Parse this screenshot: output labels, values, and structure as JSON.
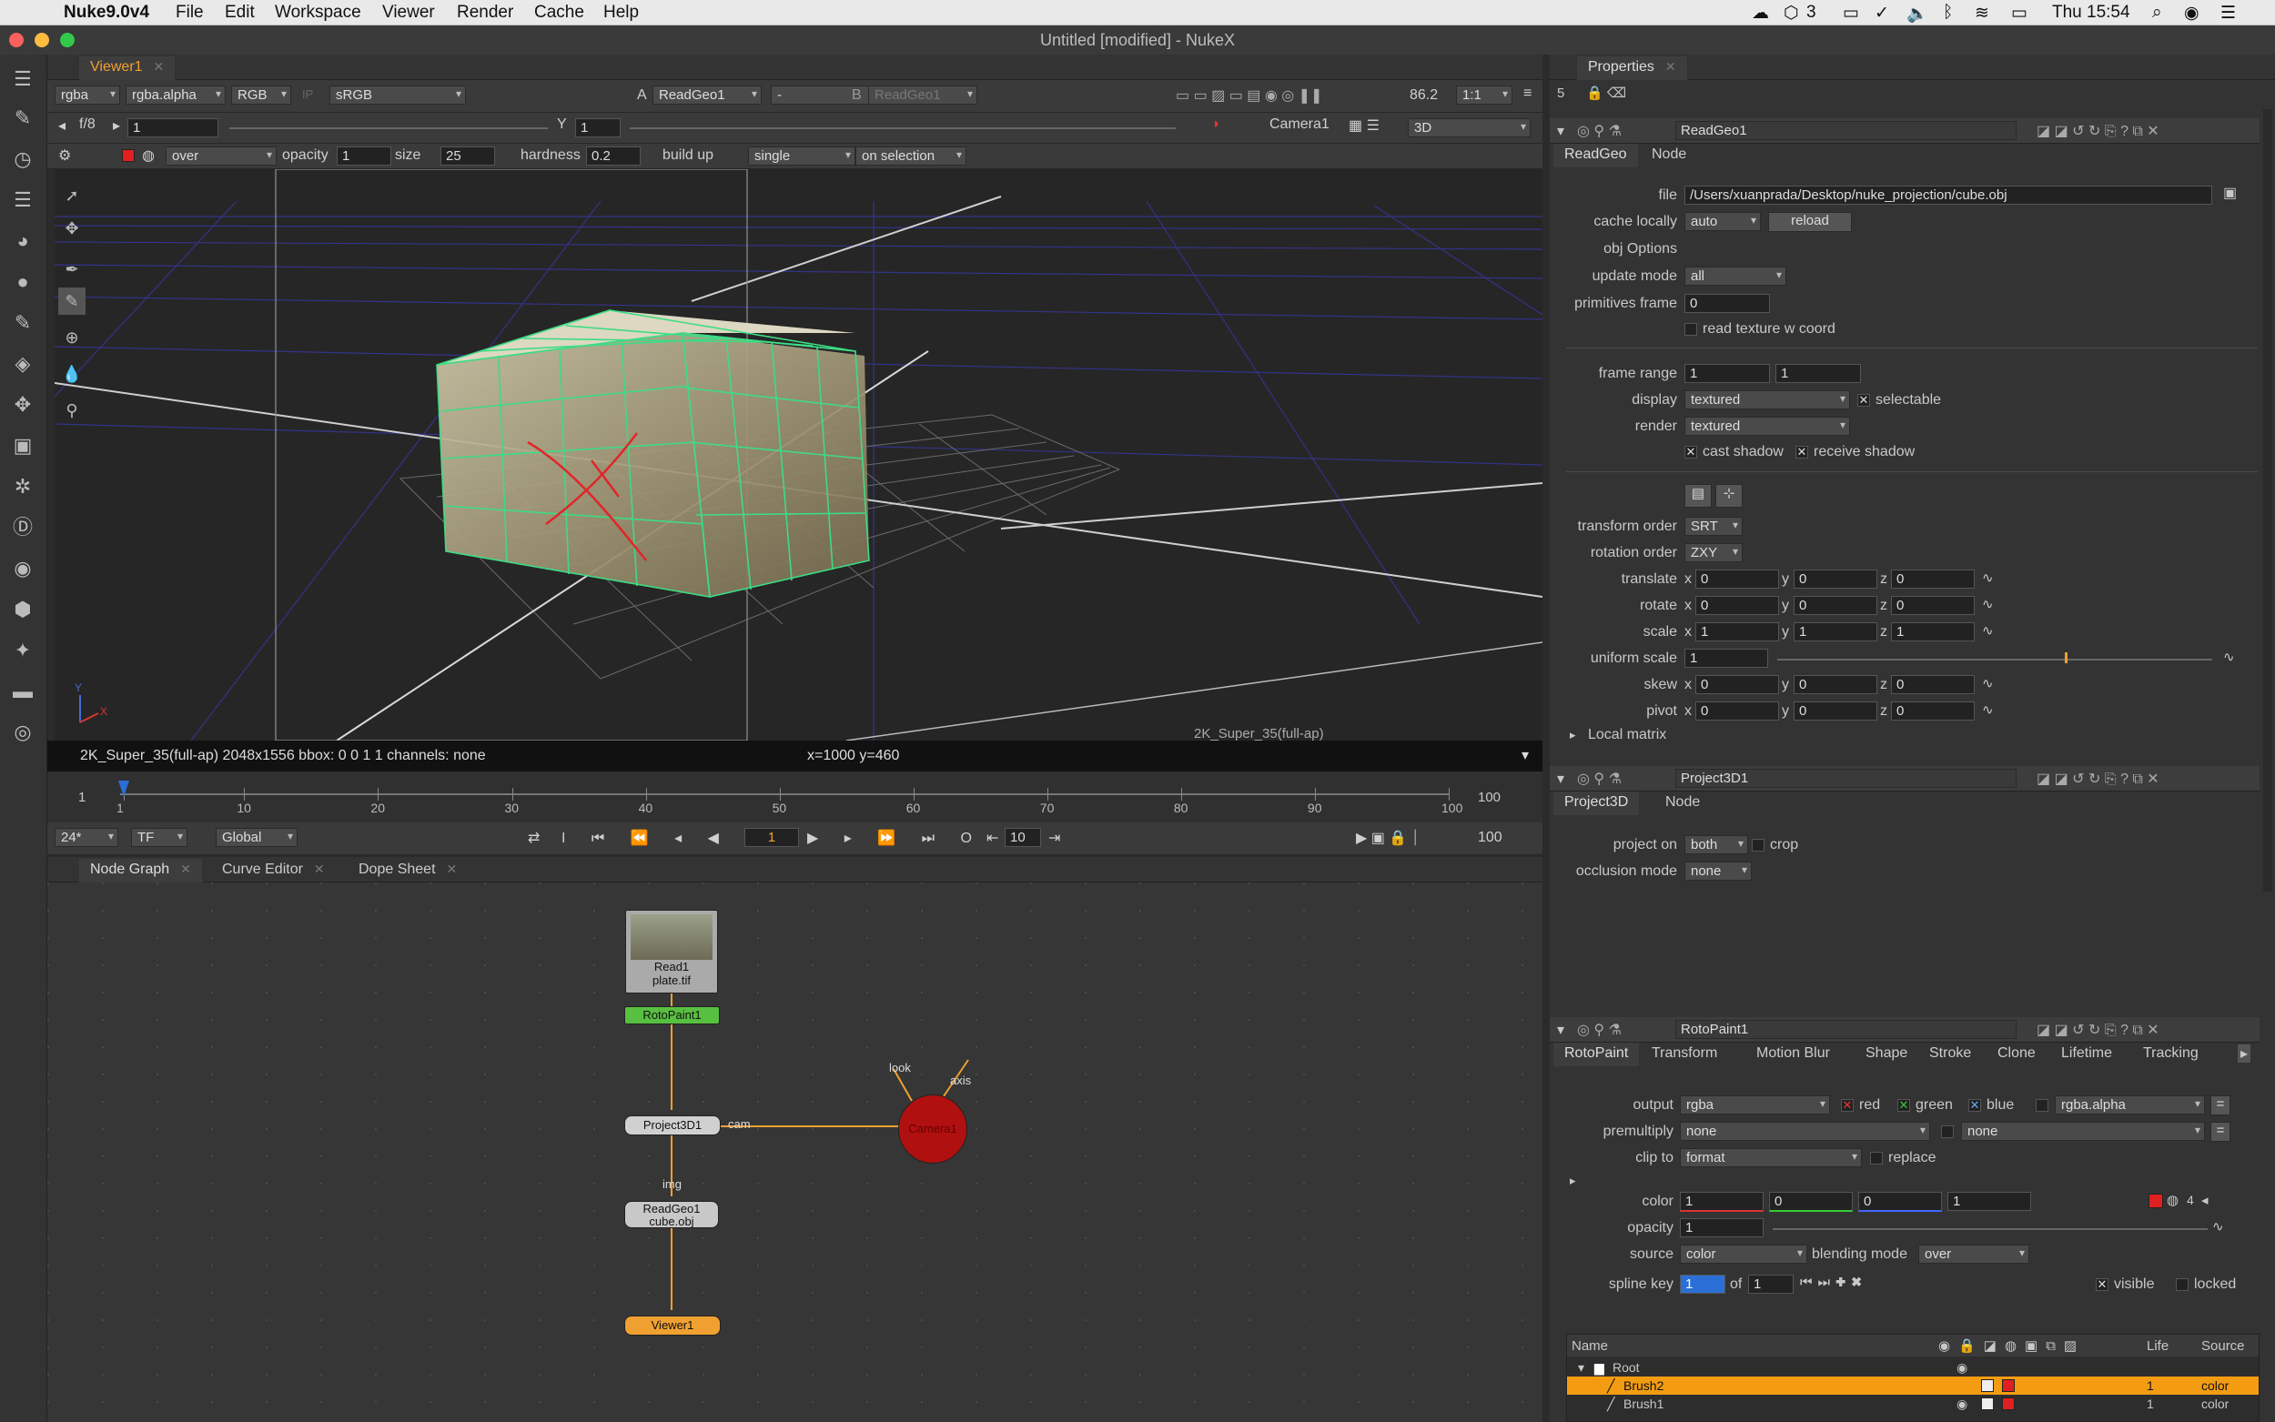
{
  "menubar": {
    "app": "Nuke9.0v4",
    "menus": [
      "File",
      "Edit",
      "Workspace",
      "Viewer",
      "Render",
      "Cache",
      "Help"
    ],
    "clock": "Thu 15:54",
    "indicator": "3"
  },
  "window": {
    "title": "Untitled [modified] - NukeX"
  },
  "viewer": {
    "tab_label": "Viewer1",
    "channels": "rgba",
    "channel_alpha": "rgba.alpha",
    "display": "RGB",
    "ip": "IP",
    "lut": "sRGB",
    "a_label": "A",
    "a_input": "ReadGeo1",
    "a_op": "-",
    "b_label": "B",
    "b_input": "ReadGeo1",
    "gain_label": "f/8",
    "gain_value": "1",
    "y_label": "Y",
    "gamma_value": "1",
    "zoom": "86.2",
    "ratio": "1:1",
    "camera": "Camera1",
    "mode": "3D",
    "paint": {
      "blend": "over",
      "opacity_label": "opacity",
      "opacity": "1",
      "size_label": "size",
      "size": "25",
      "hardness_label": "hardness",
      "hardness": "0.2",
      "buildup_label": "build up",
      "single": "single",
      "on_selection": "on selection"
    },
    "format_label": "2K_Super_35(full-ap)",
    "info": "2K_Super_35(full-ap) 2048x1556  bbox: 0 0 1 1 channels: none",
    "coords": "x=1000 y=460"
  },
  "timeline": {
    "start": "1",
    "end": "100",
    "ticks": [
      "1",
      "10",
      "20",
      "30",
      "40",
      "50",
      "60",
      "70",
      "80",
      "90",
      "100"
    ],
    "fps": "24*",
    "tf": "TF",
    "scope": "Global",
    "frame": "1",
    "step": "10",
    "end_field": "100"
  },
  "panels": {
    "tabs": [
      "Node Graph",
      "Curve Editor",
      "Dope Sheet"
    ]
  },
  "nodes": {
    "read": {
      "name": "Read1",
      "file": "plate.tif"
    },
    "roto": "RotoPaint1",
    "project": "Project3D1",
    "camera": "Camera1",
    "readgeo": {
      "name": "ReadGeo1",
      "file": "cube.obj"
    },
    "viewer": "Viewer1",
    "labels": {
      "cam": "cam",
      "img": "img",
      "look": "look",
      "axis": "axis"
    }
  },
  "properties": {
    "tab": "Properties",
    "count": "5",
    "readgeo": {
      "name": "ReadGeo1",
      "tabs": [
        "ReadGeo",
        "Node"
      ],
      "file_label": "file",
      "file": "/Users/xuanprada/Desktop/nuke_projection/cube.obj",
      "cache_label": "cache locally",
      "cache": "auto",
      "reload": "reload",
      "obj_options": "obj Options",
      "update_label": "update mode",
      "update": "all",
      "prim_label": "primitives frame",
      "prim": "0",
      "read_texture": "read texture w coord",
      "range_label": "frame range",
      "range_a": "1",
      "range_b": "1",
      "display_label": "display",
      "display": "textured",
      "selectable": "selectable",
      "render_label": "render",
      "render": "textured",
      "cast": "cast shadow",
      "receive": "receive shadow",
      "torder_label": "transform order",
      "torder": "SRT",
      "rorder_label": "rotation order",
      "rorder": "ZXY",
      "translate_label": "translate",
      "translate": [
        "0",
        "0",
        "0"
      ],
      "rotate_label": "rotate",
      "rotate": [
        "0",
        "0",
        "0"
      ],
      "scale_label": "scale",
      "scale": [
        "1",
        "1",
        "1"
      ],
      "uscale_label": "uniform scale",
      "uscale": "1",
      "skew_label": "skew",
      "skew": [
        "0",
        "0",
        "0"
      ],
      "pivot_label": "pivot",
      "pivot": [
        "0",
        "0",
        "0"
      ],
      "local_matrix": "Local matrix",
      "axes": [
        "x",
        "y",
        "z"
      ]
    },
    "project3d": {
      "name": "Project3D1",
      "tabs": [
        "Project3D",
        "Node"
      ],
      "project_label": "project on",
      "project": "both",
      "crop": "crop",
      "occl_label": "occlusion mode",
      "occl": "none"
    },
    "roto": {
      "name": "RotoPaint1",
      "tabs": [
        "RotoPaint",
        "Transform",
        "Motion Blur",
        "Shape",
        "Stroke",
        "Clone",
        "Lifetime",
        "Tracking"
      ],
      "output_label": "output",
      "output": "rgba",
      "red": "red",
      "green": "green",
      "blue": "blue",
      "alpha_ch": "rgba.alpha",
      "premult_label": "premultiply",
      "premult": "none",
      "premult_b": "none",
      "clip_label": "clip to",
      "clip": "format",
      "replace": "replace",
      "color_label": "color",
      "color": [
        "1",
        "0",
        "0",
        "1"
      ],
      "color_count": "4",
      "opacity_label": "opacity",
      "opacity": "1",
      "source_label": "source",
      "source": "color",
      "blend_label": "blending mode",
      "blend": "over",
      "spline_label": "spline key",
      "spline": "1",
      "of": "of",
      "spline_total": "1",
      "visible": "visible",
      "locked": "locked",
      "list_headers": {
        "name": "Name",
        "life": "Life",
        "source": "Source"
      },
      "items": [
        {
          "name": "Root",
          "life": "",
          "source": ""
        },
        {
          "name": "Brush2",
          "life": "1",
          "source": "color"
        },
        {
          "name": "Brush1",
          "life": "1",
          "source": "color"
        }
      ]
    }
  },
  "colors": {
    "accent": "#f0a030",
    "selection": "#f39c12",
    "cube_wire": "#3ddc84",
    "grid": "#3c3c9a"
  }
}
